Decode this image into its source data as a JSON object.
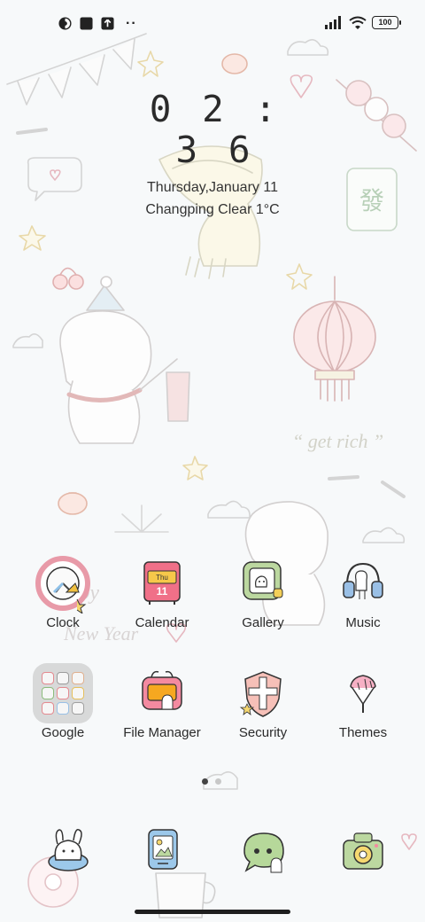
{
  "status_bar": {
    "left_icons": [
      "browser-icon",
      "square-notification-icon",
      "upload-icon",
      "more-dots-icon"
    ],
    "more_dots": "··",
    "right_icons": [
      "signal-icon",
      "wifi-icon",
      "battery-icon"
    ],
    "battery_level": "100"
  },
  "clock_widget": {
    "time": "02:36",
    "date": "Thursday,January 11",
    "weather": "Changping Clear 1°C"
  },
  "wallpaper": {
    "texts": [
      "Happy",
      "New Year",
      "“ get rich ”"
    ]
  },
  "apps": [
    {
      "label": "Clock",
      "icon": "clock-icon"
    },
    {
      "label": "Calendar",
      "icon": "calendar-icon",
      "icon_text_top": "Thu",
      "icon_text_day": "11"
    },
    {
      "label": "Gallery",
      "icon": "gallery-icon"
    },
    {
      "label": "Music",
      "icon": "music-icon"
    },
    {
      "label": "Google",
      "icon": "google-folder-icon"
    },
    {
      "label": "File Manager",
      "icon": "file-manager-icon"
    },
    {
      "label": "Security",
      "icon": "security-icon"
    },
    {
      "label": "Themes",
      "icon": "themes-icon"
    }
  ],
  "page_indicator": {
    "pages": 2,
    "current": 1
  },
  "dock": [
    {
      "icon": "phone-icon"
    },
    {
      "icon": "contacts-icon"
    },
    {
      "icon": "messages-icon"
    },
    {
      "icon": "camera-icon"
    }
  ],
  "colors": {
    "background": "#f7f9fa",
    "text": "#2a2a2a",
    "accent_pink": "#e8889a",
    "accent_green": "#b8d8a0",
    "accent_blue": "#a8c8e8",
    "accent_yellow": "#f0c830"
  }
}
